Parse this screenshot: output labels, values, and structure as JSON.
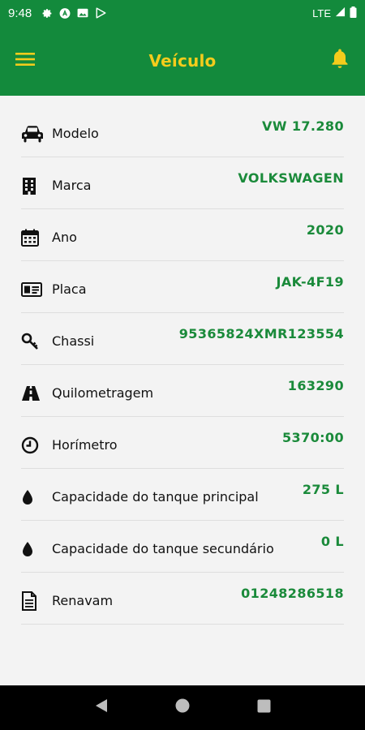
{
  "status_bar": {
    "time": "9:48",
    "network": "LTE"
  },
  "app_bar": {
    "title": "Veículo"
  },
  "colors": {
    "primary": "#138a3c",
    "accent": "#f3cc1c",
    "value": "#1a8a3a"
  },
  "fields": [
    {
      "icon": "car-icon",
      "label": "Modelo",
      "value": "VW 17.280"
    },
    {
      "icon": "building-icon",
      "label": "Marca",
      "value": "VOLKSWAGEN"
    },
    {
      "icon": "calendar-icon",
      "label": "Ano",
      "value": "2020"
    },
    {
      "icon": "id-card-icon",
      "label": "Placa",
      "value": "JAK-4F19"
    },
    {
      "icon": "key-icon",
      "label": "Chassi",
      "value": "95365824XMR123554"
    },
    {
      "icon": "road-icon",
      "label": "Quilometragem",
      "value": "163290"
    },
    {
      "icon": "clock-icon",
      "label": "Horímetro",
      "value": "5370:00"
    },
    {
      "icon": "drop-icon",
      "label": "Capacidade do tanque principal",
      "value": "275 L"
    },
    {
      "icon": "drop-icon",
      "label": "Capacidade do tanque secundário",
      "value": "0 L"
    },
    {
      "icon": "document-icon",
      "label": "Renavam",
      "value": "01248286518"
    }
  ]
}
